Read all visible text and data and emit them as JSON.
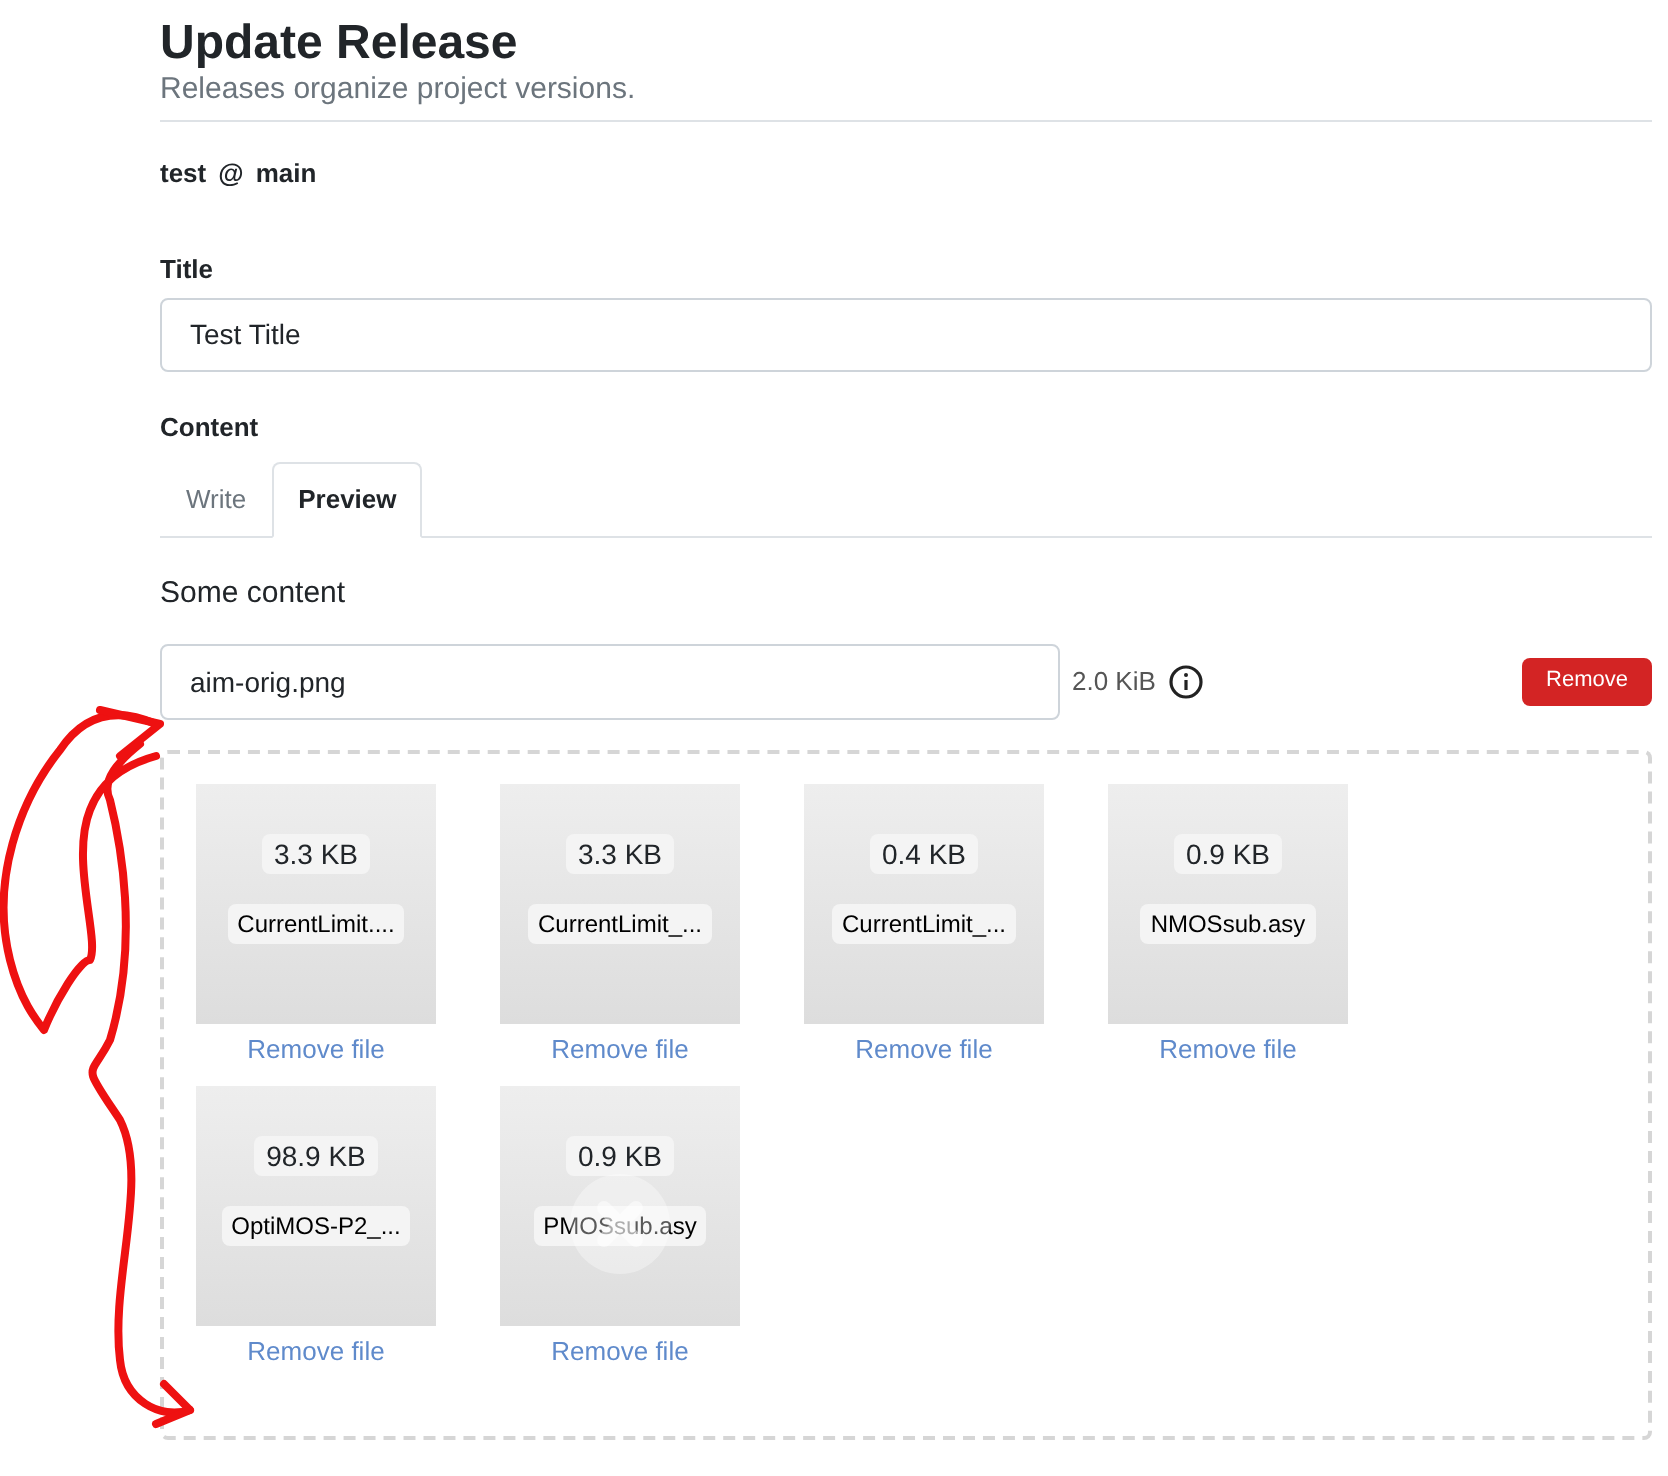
{
  "header": {
    "title": "Update Release",
    "subtitle": "Releases organize project versions."
  },
  "tag": {
    "name": "test",
    "separator": "@",
    "branch": "main"
  },
  "title_field": {
    "label": "Title",
    "value": "Test Title"
  },
  "content": {
    "label": "Content",
    "tabs": [
      {
        "label": "Write",
        "selected": false
      },
      {
        "label": "Preview",
        "selected": true
      }
    ],
    "preview_text": "Some content"
  },
  "attachment": {
    "name": "aim-orig.png",
    "size": "2.0 KiB",
    "remove": "Remove"
  },
  "dropzone": {
    "files": [
      {
        "size": "3.3 KB",
        "name": "CurrentLimit....",
        "remove": "Remove file",
        "hovered": false
      },
      {
        "size": "3.3 KB",
        "name": "CurrentLimit_...",
        "remove": "Remove file",
        "hovered": false
      },
      {
        "size": "0.4 KB",
        "name": "CurrentLimit_...",
        "remove": "Remove file",
        "hovered": false
      },
      {
        "size": "0.9 KB",
        "name": "NMOSsub.asy",
        "remove": "Remove file",
        "hovered": false
      },
      {
        "size": "98.9 KB",
        "name": "OptiMOS-P2_...",
        "remove": "Remove file",
        "hovered": false
      },
      {
        "size": "0.9 KB",
        "name": "PMOSsub.asy",
        "remove": "Remove file",
        "hovered": true
      }
    ]
  }
}
